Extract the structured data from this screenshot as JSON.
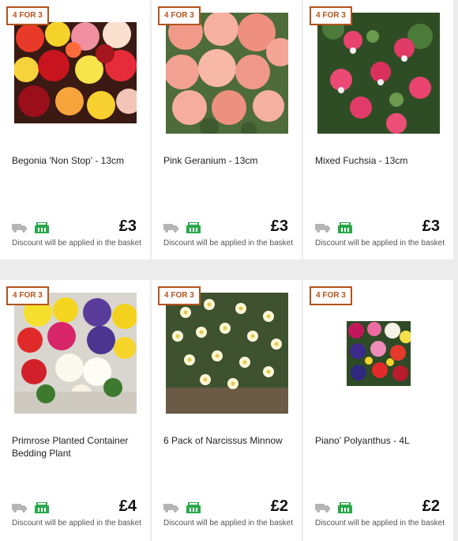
{
  "products": [
    {
      "badge": "4 FOR 3",
      "title": "Begonia 'Non Stop' - 13cm",
      "price": "£3",
      "discount": "Discount will be applied in the basket",
      "image": "begonia"
    },
    {
      "badge": "4 FOR 3",
      "title": "Pink Geranium - 13cm",
      "price": "£3",
      "discount": "Discount will be applied in the basket",
      "image": "geranium"
    },
    {
      "badge": "4 FOR 3",
      "title": "Mixed Fuchsia - 13cm",
      "price": "£3",
      "discount": "Discount will be applied in the basket",
      "image": "fuchsia"
    },
    {
      "badge": "4 FOR 3",
      "title": "Primrose Planted Container Bedding Plant",
      "price": "£4",
      "discount": "Discount will be applied in the basket",
      "image": "primrose"
    },
    {
      "badge": "4 FOR 3",
      "title": "6 Pack of Narcissus Minnow",
      "price": "£2",
      "discount": "Discount will be applied in the basket",
      "image": "narcissus"
    },
    {
      "badge": "4 FOR 3",
      "title": "Piano' Polyanthus - 4L",
      "price": "£2",
      "discount": "Discount will be applied in the basket",
      "image": "polyanthus"
    }
  ],
  "icons": {
    "delivery": "delivery-truck-icon",
    "collect": "basket-collect-icon"
  },
  "colors": {
    "badge": "#b3541e",
    "collect": "#2aa84a",
    "delivery": "#b5b5b5",
    "background": "#ececec"
  }
}
